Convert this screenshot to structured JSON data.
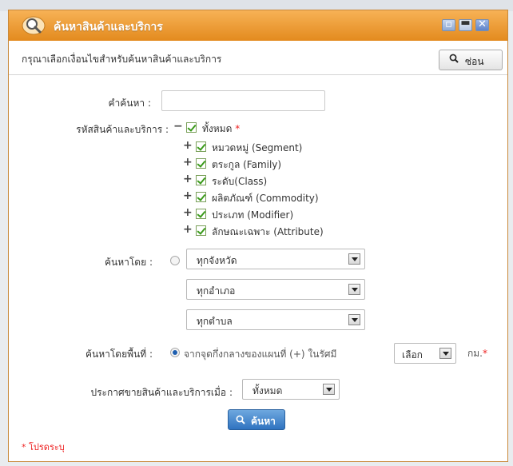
{
  "dialog": {
    "title": "ค้นหาสินค้าและบริการ",
    "subheader": "กรุณาเลือกเงื่อนไขสำหรับค้นหาสินค้าและบริการ",
    "hide_button": "ซ่อน"
  },
  "form": {
    "keyword_label": "คำค้นหา :",
    "keyword_value": "",
    "code_label": "รหัสสินค้าและบริการ :",
    "tree": {
      "root": {
        "toggle": "−",
        "label": "ทั้งหมด",
        "required": "*",
        "checked": true
      },
      "children": [
        {
          "toggle": "+",
          "label": "หมวดหมู่ (Segment)",
          "checked": true
        },
        {
          "toggle": "+",
          "label": "ตระกูล (Family)",
          "checked": true
        },
        {
          "toggle": "+",
          "label": "ระดับ(Class)",
          "checked": true
        },
        {
          "toggle": "+",
          "label": "ผลิตภัณฑ์ (Commodity)",
          "checked": true
        },
        {
          "toggle": "+",
          "label": "ประเภท (Modifier)",
          "checked": true
        },
        {
          "toggle": "+",
          "label": "ลักษณะเฉพาะ (Attribute)",
          "checked": true
        }
      ]
    },
    "search_by_label": "ค้นหาโดย :",
    "province_select": "ทุกจังหวัด",
    "district_select": "ทุกอำเภอ",
    "subdistrict_select": "ทุกตำบล",
    "area_label": "ค้นหาโดยพื้นที่ :",
    "area_option_text": "จากจุดกึ่งกลางของแผนที่ (+) ในรัศมี",
    "radius_select": "เลือก",
    "radius_unit": "กม.",
    "radius_required": "*",
    "announce_label": "ประกาศขายสินค้าและบริการเมื่อ :",
    "announce_select": "ทั้งหมด",
    "search_button": "ค้นหา",
    "required_note": "* โปรดระบุ"
  },
  "colors": {
    "titlebar": "#e38a1e",
    "search_button": "#2f73c0",
    "required": "#e22222",
    "checkbox_check": "#3a9a1a"
  }
}
